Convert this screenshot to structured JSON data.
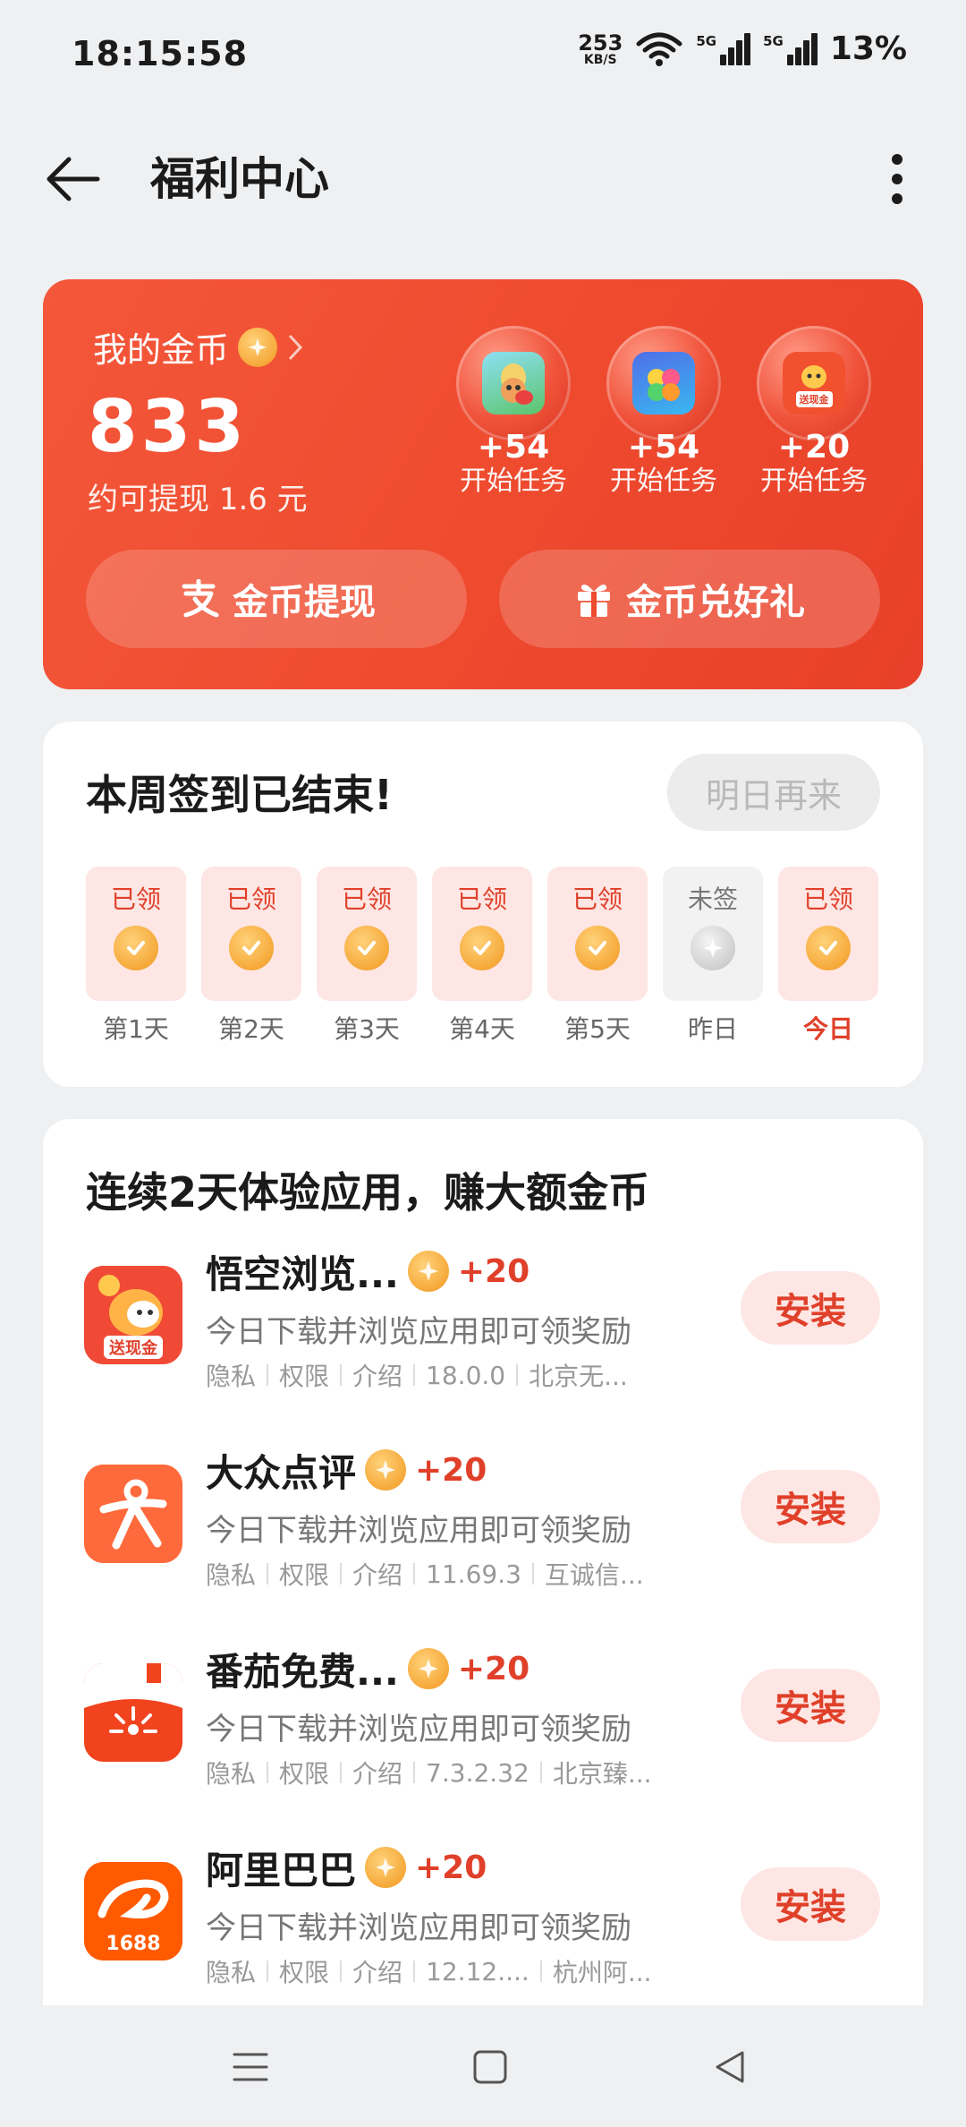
{
  "status_bar": {
    "time": "18:15:58",
    "net_speed": "253",
    "net_unit": "KB/S",
    "sim1": "5G",
    "sim2": "5G",
    "battery": "13%"
  },
  "header": {
    "title": "福利中心"
  },
  "coin_card": {
    "title": "我的金币",
    "value": "833",
    "subtitle": "约可提现 1.6 元",
    "tasks": [
      {
        "reward": "+54",
        "label": "开始任务",
        "icon": "monkey-game-icon"
      },
      {
        "reward": "+54",
        "label": "开始任务",
        "icon": "puzzle-game-icon"
      },
      {
        "reward": "+20",
        "label": "开始任务",
        "icon": "cash-gift-app-icon",
        "badge": "送现金"
      }
    ],
    "buttons": {
      "withdraw": "金币提现",
      "exchange": "金币兑好礼"
    }
  },
  "signin": {
    "title": "本周签到已结束!",
    "tomorrow_button": "明日再来",
    "days": [
      {
        "status": "已领",
        "label": "第1天",
        "claimed": true
      },
      {
        "status": "已领",
        "label": "第2天",
        "claimed": true
      },
      {
        "status": "已领",
        "label": "第3天",
        "claimed": true
      },
      {
        "status": "已领",
        "label": "第4天",
        "claimed": true
      },
      {
        "status": "已领",
        "label": "第5天",
        "claimed": true
      },
      {
        "status": "未签",
        "label": "昨日",
        "claimed": false
      },
      {
        "status": "已领",
        "label": "今日",
        "claimed": true
      }
    ]
  },
  "apps": {
    "title": "连续2天体验应用，赚大额金币",
    "install_label": "安装",
    "meta_privacy": "隐私",
    "meta_permission": "权限",
    "meta_intro": "介绍",
    "items": [
      {
        "name": "悟空浏览...",
        "reward": "+20",
        "desc": "今日下载并浏览应用即可领奖励",
        "version": "18.0.0",
        "developer": "北京无...",
        "icon_badge": "送现金",
        "icon_color": "#f04a36"
      },
      {
        "name": "大众点评",
        "reward": "+20",
        "desc": "今日下载并浏览应用即可领奖励",
        "version": "11.69.3",
        "developer": "互诚信...",
        "icon_color": "#ff6a3c"
      },
      {
        "name": "番茄免费...",
        "reward": "+20",
        "desc": "今日下载并浏览应用即可领奖励",
        "version": "7.3.2.32",
        "developer": "北京臻...",
        "icon_color": "#f0431e"
      },
      {
        "name": "阿里巴巴",
        "reward": "+20",
        "desc": "今日下载并浏览应用即可领奖励",
        "version": "12.12....",
        "developer": "杭州阿...",
        "icon_badge": "1688",
        "icon_color": "#ff5a00"
      }
    ]
  }
}
